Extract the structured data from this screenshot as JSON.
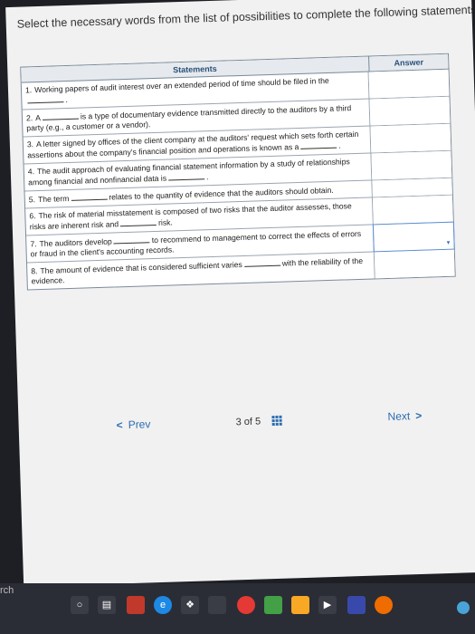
{
  "instruction": "Select the necessary words from the list of possibilities to complete the following statements.",
  "table": {
    "header_statements": "Statements",
    "header_answer": "Answer",
    "rows": [
      {
        "num": "1.",
        "pre": "Working papers of audit interest over an extended period of time should be filed in the",
        "post": "."
      },
      {
        "num": "2.",
        "pre": "A",
        "post": "is a type of documentary evidence transmitted directly to the auditors by a third party (e.g., a customer or a vendor)."
      },
      {
        "num": "3.",
        "pre": "A letter signed by offices of the client company at the auditors' request which sets forth certain assertions about the company's financial position and operations is known as a",
        "post": "."
      },
      {
        "num": "4.",
        "pre": "The audit approach of evaluating financial statement information by a study of relationships among financial and nonfinancial data is",
        "post": "."
      },
      {
        "num": "5.",
        "pre": "The term",
        "post": "relates to the quantity of evidence that the auditors should obtain."
      },
      {
        "num": "6.",
        "pre": "The risk of material misstatement is composed of two risks that the auditor assesses, those risks are inherent risk and",
        "post": "risk."
      },
      {
        "num": "7.",
        "pre": "The auditors develop",
        "post": "to recommend to management to correct the effects of errors or fraud in the client's accounting records."
      },
      {
        "num": "8.",
        "pre": "The amount of evidence that is considered sufficient varies",
        "post": "with the reliability of the evidence."
      }
    ]
  },
  "nav": {
    "prev_label": "Prev",
    "page_current": "3",
    "page_of": "of",
    "page_total": "5",
    "next_label": "Next"
  },
  "taskbar": {
    "search_text": "rch"
  }
}
